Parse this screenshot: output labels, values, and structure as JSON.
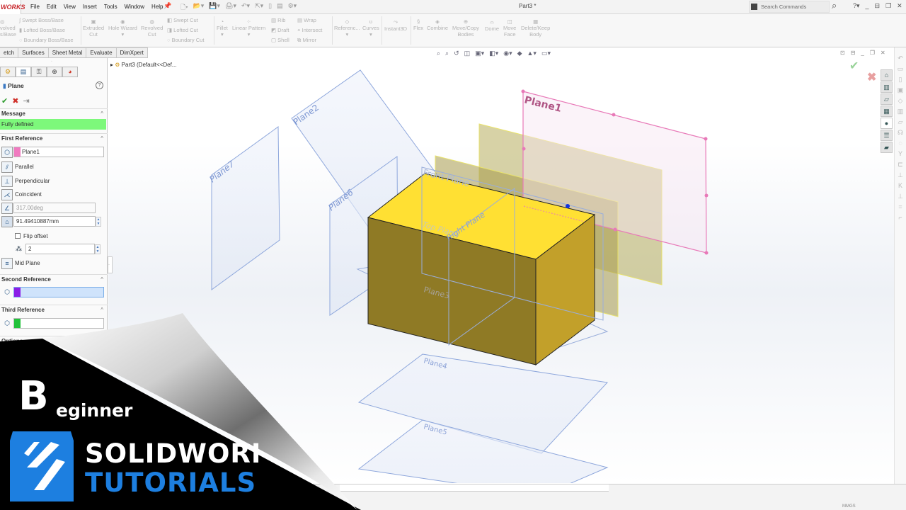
{
  "app": {
    "logo_text": "WORKS",
    "document_title": "Part3 *"
  },
  "menu": [
    "File",
    "Edit",
    "View",
    "Insert",
    "Tools",
    "Window",
    "Help"
  ],
  "quick_access": [
    "new-document-icon",
    "open-icon",
    "save-icon",
    "print-icon",
    "undo-icon",
    "select-icon",
    "rebuild-icon",
    "file-properties-icon",
    "options-gear-icon"
  ],
  "search": {
    "placeholder": "Search Commands"
  },
  "ribbon": {
    "items": [
      {
        "label": "Revolved Boss/Base",
        "line1": "volved",
        "line2": "s/Base"
      },
      {
        "label": "Swept Boss/Base"
      },
      {
        "label": "Lofted Boss/Base"
      },
      {
        "label": "Boundary Boss/Base"
      },
      {
        "label": "Extruded Cut",
        "line1": "Extruded",
        "line2": "Cut"
      },
      {
        "label": "Hole Wizard"
      },
      {
        "label": "Revolved Cut",
        "line1": "Revolved",
        "line2": "Cut"
      },
      {
        "label": "Swept Cut"
      },
      {
        "label": "Lofted Cut"
      },
      {
        "label": "Boundary Cut"
      },
      {
        "label": "Fillet"
      },
      {
        "label": "Linear Pattern"
      },
      {
        "label": "Rib"
      },
      {
        "label": "Draft"
      },
      {
        "label": "Shell"
      },
      {
        "label": "Wrap"
      },
      {
        "label": "Intersect"
      },
      {
        "label": "Mirror"
      },
      {
        "label": "Referenc..."
      },
      {
        "label": "Curves"
      },
      {
        "label": "Instant3D"
      },
      {
        "label": "Flex"
      },
      {
        "label": "Combine"
      },
      {
        "label": "Move/Copy Bodies",
        "line1": "Move/Copy",
        "line2": "Bodies"
      },
      {
        "label": "Dome"
      },
      {
        "label": "Move Face",
        "line1": "Move",
        "line2": "Face"
      },
      {
        "label": "Delete/Keep Body",
        "line1": "Delete/Keep",
        "line2": "Body"
      }
    ]
  },
  "command_tabs": [
    "etch",
    "Surfaces",
    "Sheet Metal",
    "Evaluate",
    "DimXpert"
  ],
  "tree": {
    "root": "Part3  (Default<<Def..."
  },
  "property_manager": {
    "title": "Plane",
    "tabs": [
      "feature-manager-icon",
      "property-manager-icon",
      "configuration-manager-icon",
      "dimxpert-icon",
      "display-manager-icon"
    ],
    "message_header": "Message",
    "message": "Fully defined",
    "first_reference": {
      "header": "First Reference",
      "selection": "Plane1",
      "chip_color": "#f07ac0",
      "constraints": [
        "Parallel",
        "Perpendicular",
        "Coincident"
      ],
      "angle": "317.00deg",
      "offset": "91.49410887mm",
      "flip_offset_label": "Flip offset",
      "flip_offset": false,
      "instances": "2",
      "mid_plane": "Mid Plane"
    },
    "second_reference": {
      "header": "Second Reference",
      "chip_color": "#8a1ee6",
      "selection": ""
    },
    "third_reference": {
      "header": "Third Reference",
      "chip_color": "#22c23a",
      "selection": ""
    },
    "options_header": "Options"
  },
  "viewport": {
    "plane_labels": [
      "Plane1",
      "Plane2",
      "Plane3",
      "Plane4",
      "Plane5",
      "Plane6",
      "Plane7",
      "Front Plane",
      "Top Plane",
      "Right Plane"
    ],
    "colors": {
      "solid_top": "#ffe033",
      "solid_front": "#8f7a25",
      "solid_side": "#c2a02a",
      "plane_blue": "#7e9ad8",
      "plane1_pink": "#e879b8",
      "preview_yellow": "#e9e36a"
    }
  },
  "status_bar": {
    "units": "MMGS"
  },
  "branding": {
    "big_letter": "B",
    "word": "eginner",
    "line1": "SOLIDWORKS",
    "line2": "TUTORIALS",
    "blue": "#1d7fe0"
  }
}
